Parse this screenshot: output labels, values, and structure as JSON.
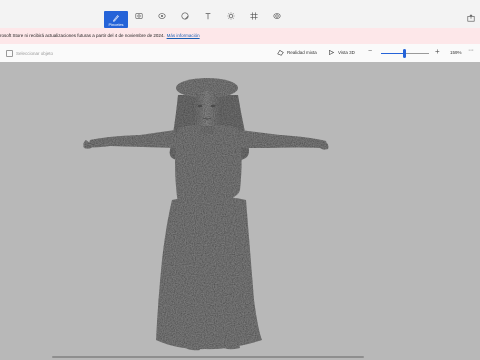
{
  "toolbar": {
    "tools": [
      {
        "name": "brushes",
        "label": "Pinceles",
        "icon": "brush-icon",
        "active": true
      },
      {
        "name": "shapes-2d",
        "icon": "2d-shapes-icon"
      },
      {
        "name": "shapes-3d",
        "icon": "3d-shapes-icon"
      },
      {
        "name": "stickers",
        "icon": "stickers-icon"
      },
      {
        "name": "text",
        "icon": "text-icon"
      },
      {
        "name": "effects",
        "icon": "effects-icon"
      },
      {
        "name": "canvas",
        "icon": "canvas-icon"
      },
      {
        "name": "3d-library",
        "icon": "3d-library-icon"
      }
    ],
    "accent": "#2563d8"
  },
  "banner": {
    "message": "rosoft Store ni recibirá actualizaciones futuras a partir del 4 de noviembre de 2024.",
    "link": "Más información",
    "background": "#fde7e9"
  },
  "cmdbar": {
    "select_placeholder": "Seleccionar objeto",
    "mixed_reality_label": "Realidad mixta",
    "view_3d_label": "Vista 3D",
    "zoom_value": "159%",
    "zoom_level": 0.52,
    "more_label": "···"
  },
  "canvas": {
    "background": "#b8b8b8",
    "model_description_color": "#6e6e6e"
  }
}
